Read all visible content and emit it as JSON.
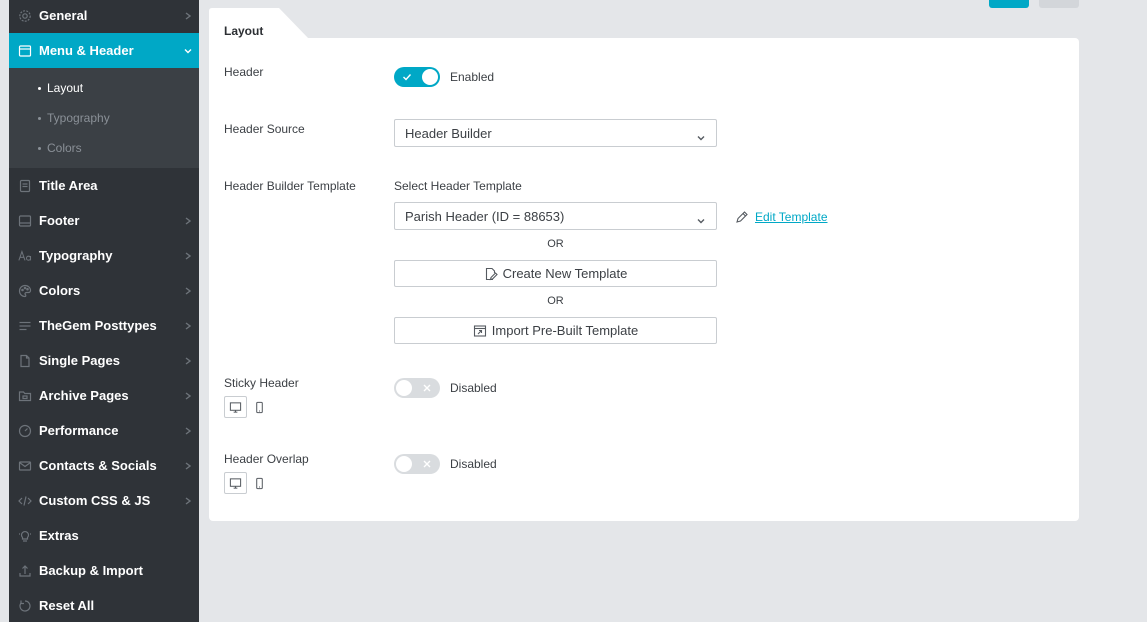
{
  "sidebar": {
    "items": [
      {
        "label": "General",
        "icon": "gear-icon"
      },
      {
        "label": "Menu & Header",
        "icon": "window-icon"
      },
      {
        "label": "Title Area",
        "icon": "document-icon"
      },
      {
        "label": "Footer",
        "icon": "footer-icon"
      },
      {
        "label": "Typography",
        "icon": "font-icon"
      },
      {
        "label": "Colors",
        "icon": "palette-icon"
      },
      {
        "label": "TheGem Posttypes",
        "icon": "list-icon"
      },
      {
        "label": "Single Pages",
        "icon": "page-icon"
      },
      {
        "label": "Archive Pages",
        "icon": "folder-icon"
      },
      {
        "label": "Performance",
        "icon": "gauge-icon"
      },
      {
        "label": "Contacts & Socials",
        "icon": "envelope-icon"
      },
      {
        "label": "Custom CSS & JS",
        "icon": "code-icon"
      },
      {
        "label": "Extras",
        "icon": "bulb-icon"
      },
      {
        "label": "Backup & Import",
        "icon": "upload-icon"
      },
      {
        "label": "Reset All",
        "icon": "reset-icon"
      }
    ],
    "submenu": [
      {
        "label": "Layout"
      },
      {
        "label": "Typography"
      },
      {
        "label": "Colors"
      }
    ]
  },
  "panel": {
    "tab_label": "Layout",
    "header": {
      "label": "Header",
      "state": "Enabled"
    },
    "header_source": {
      "label": "Header Source",
      "value": "Header Builder"
    },
    "header_builder_template": {
      "label": "Header Builder Template",
      "select_label": "Select Header Template",
      "value": "Parish Header (ID = 88653)",
      "edit_link": "Edit Template",
      "or_1": "OR",
      "create_button": "Create New Template",
      "or_2": "OR",
      "import_button": "Import Pre-Built Template"
    },
    "sticky_header": {
      "label": "Sticky Header",
      "state": "Disabled"
    },
    "header_overlap": {
      "label": "Header Overlap",
      "state": "Disabled"
    }
  },
  "colors": {
    "accent": "#00a8c6",
    "sidebar_bg": "#2f3338",
    "submenu_bg": "#3b4045",
    "page_bg": "#e4e6e9"
  }
}
